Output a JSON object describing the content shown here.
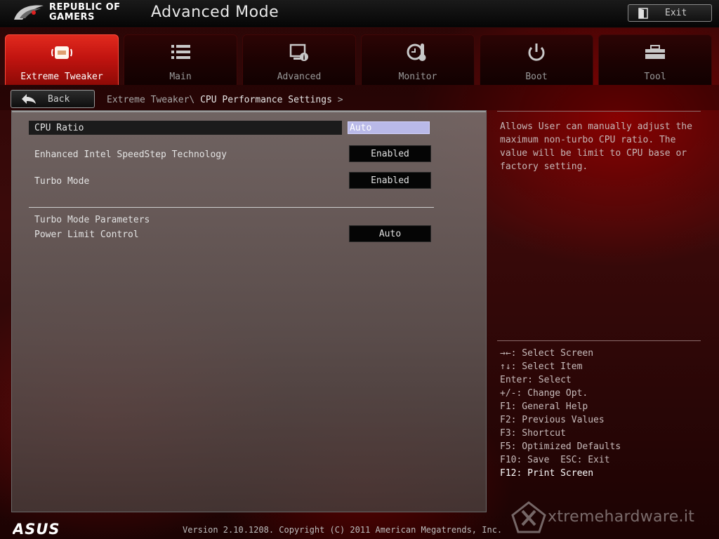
{
  "header": {
    "brand_line1": "REPUBLIC OF",
    "brand_line2": "GAMERS",
    "title": "Advanced Mode",
    "exit_label": "Exit"
  },
  "tabs": [
    {
      "label": "Extreme Tweaker",
      "icon": "extreme-tweaker-icon",
      "active": true
    },
    {
      "label": "Main",
      "icon": "list-icon",
      "active": false
    },
    {
      "label": "Advanced",
      "icon": "advanced-settings-icon",
      "active": false
    },
    {
      "label": "Monitor",
      "icon": "thermometer-icon",
      "active": false
    },
    {
      "label": "Boot",
      "icon": "power-icon",
      "active": false
    },
    {
      "label": "Tool",
      "icon": "toolbox-icon",
      "active": false
    }
  ],
  "subbar": {
    "back_label": "Back",
    "breadcrumb_parent": "Extreme Tweaker\\",
    "breadcrumb_current": "CPU Performance Settings",
    "breadcrumb_arrow": ">"
  },
  "settings": [
    {
      "label": "CPU Ratio",
      "value": "Auto",
      "selected": true
    },
    {
      "label": "Enhanced Intel SpeedStep Technology",
      "value": "Enabled",
      "selected": false
    },
    {
      "label": "Turbo Mode",
      "value": "Enabled",
      "selected": false
    }
  ],
  "turbo_section": {
    "heading": "Turbo Mode Parameters",
    "power_limit_label": "Power Limit Control",
    "power_limit_value": "Auto"
  },
  "help": {
    "description": "Allows User can manually adjust the maximum non-turbo CPU ratio. The value will be limit to CPU base or factory setting."
  },
  "keys": [
    "→←: Select Screen",
    "↑↓: Select Item",
    "Enter: Select",
    "+/-: Change Opt.",
    "F1: General Help",
    "F2: Previous Values",
    "F3: Shortcut",
    "F5: Optimized Defaults",
    "F10: Save  ESC: Exit",
    "F12: Print Screen"
  ],
  "footer": {
    "version": "Version 2.10.1208. Copyright (C) 2011 American Megatrends, Inc.",
    "asus_logo": "ASUS",
    "watermark": "xtremehardware.it"
  },
  "colors": {
    "accent_red": "#d81e14",
    "selection_highlight": "#b9b9e8"
  }
}
